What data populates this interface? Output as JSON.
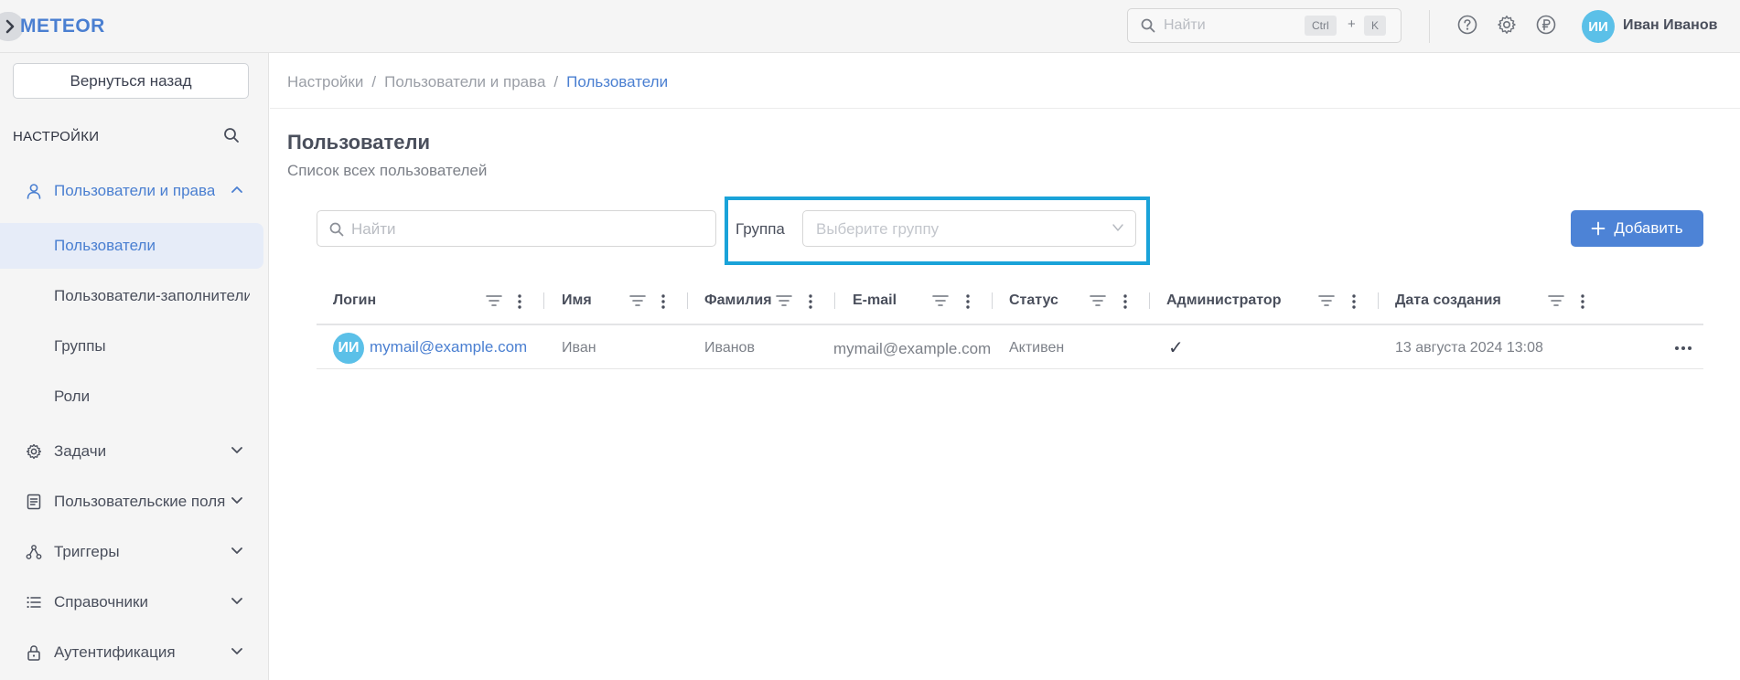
{
  "app": {
    "logo": "METEOR"
  },
  "topbar": {
    "search_placeholder": "Найти",
    "shortcut_ctrl": "Ctrl",
    "shortcut_plus": "+",
    "shortcut_key": "K",
    "user_initials": "ИИ",
    "user_name": "Иван Иванов",
    "icons": [
      "search-icon",
      "help-icon",
      "gear-icon",
      "ruble-icon"
    ]
  },
  "sidebar": {
    "back_label": "Вернуться назад",
    "section_title": "НАСТРОЙКИ",
    "items": [
      {
        "label": "Пользователи и права",
        "icon": "user-icon",
        "expanded": true
      },
      {
        "label": "Задачи",
        "icon": "gear-icon"
      },
      {
        "label": "Пользовательские поля",
        "icon": "form-icon"
      },
      {
        "label": "Триггеры",
        "icon": "trigger-icon"
      },
      {
        "label": "Справочники",
        "icon": "list-icon"
      },
      {
        "label": "Аутентификация",
        "icon": "lock-icon"
      }
    ],
    "subitems": [
      {
        "label": "Пользователи",
        "active": true
      },
      {
        "label": "Пользователи-заполнители"
      },
      {
        "label": "Группы"
      },
      {
        "label": "Роли"
      }
    ]
  },
  "breadcrumb": [
    "Настройки",
    "Пользователи и права",
    "Пользователи"
  ],
  "breadcrumb_sep": "/",
  "page": {
    "title": "Пользователи",
    "subtitle": "Список всех пользователей"
  },
  "filters": {
    "search_placeholder": "Найти",
    "group_label": "Группа",
    "group_placeholder": "Выберите группу",
    "add_label": "Добавить"
  },
  "table": {
    "columns": [
      "Логин",
      "Имя",
      "Фамилия",
      "E-mail",
      "Статус",
      "Администратор",
      "Дата создания"
    ],
    "rows": [
      {
        "initials": "ИИ",
        "login": "mymail@example.com",
        "first_name": "Иван",
        "last_name": "Иванов",
        "email": "mymail@example.com",
        "status": "Активен",
        "admin": "✓",
        "created": "13 августа 2024 13:08"
      }
    ]
  },
  "colors": {
    "accent": "#4a7fd1",
    "highlight": "#1aa3d9",
    "avatar": "#5bc0e8",
    "button": "#4d83d6"
  }
}
